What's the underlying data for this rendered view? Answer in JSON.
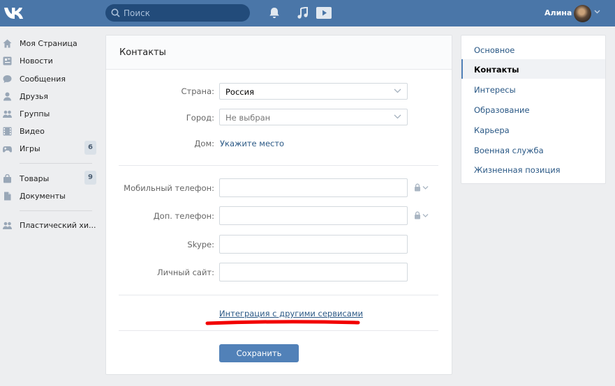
{
  "header": {
    "search_placeholder": "Поиск",
    "user_name": "Алина",
    "accent_color": "#4a76a8"
  },
  "left_nav": {
    "items": [
      {
        "label": "Моя Страница",
        "icon": "home-icon"
      },
      {
        "label": "Новости",
        "icon": "news-icon"
      },
      {
        "label": "Сообщения",
        "icon": "messages-icon"
      },
      {
        "label": "Друзья",
        "icon": "friends-icon"
      },
      {
        "label": "Группы",
        "icon": "groups-icon"
      },
      {
        "label": "Видео",
        "icon": "video-icon"
      },
      {
        "label": "Игры",
        "icon": "games-icon",
        "count": "6"
      },
      {
        "label": "Товары",
        "icon": "market-icon",
        "count": "9"
      },
      {
        "label": "Документы",
        "icon": "documents-icon"
      },
      {
        "label": "Пластический хи...",
        "icon": "group-icon"
      }
    ]
  },
  "main": {
    "title": "Контакты",
    "country_label": "Страна:",
    "country_value": "Россия",
    "city_label": "Город:",
    "city_value": "Не выбран",
    "home_label": "Дом:",
    "home_link": "Укажите место",
    "mobile_label": "Мобильный телефон:",
    "extra_phone_label": "Доп. телефон:",
    "skype_label": "Skype:",
    "site_label": "Личный сайт:",
    "integration_link": "Интеграция с другими сервисами",
    "save_label": "Сохранить"
  },
  "right_menu": {
    "items": [
      {
        "label": "Основное",
        "active": false
      },
      {
        "label": "Контакты",
        "active": true
      },
      {
        "label": "Интересы",
        "active": false
      },
      {
        "label": "Образование",
        "active": false
      },
      {
        "label": "Карьера",
        "active": false
      },
      {
        "label": "Военная служба",
        "active": false
      },
      {
        "label": "Жизненная позиция",
        "active": false
      }
    ]
  }
}
